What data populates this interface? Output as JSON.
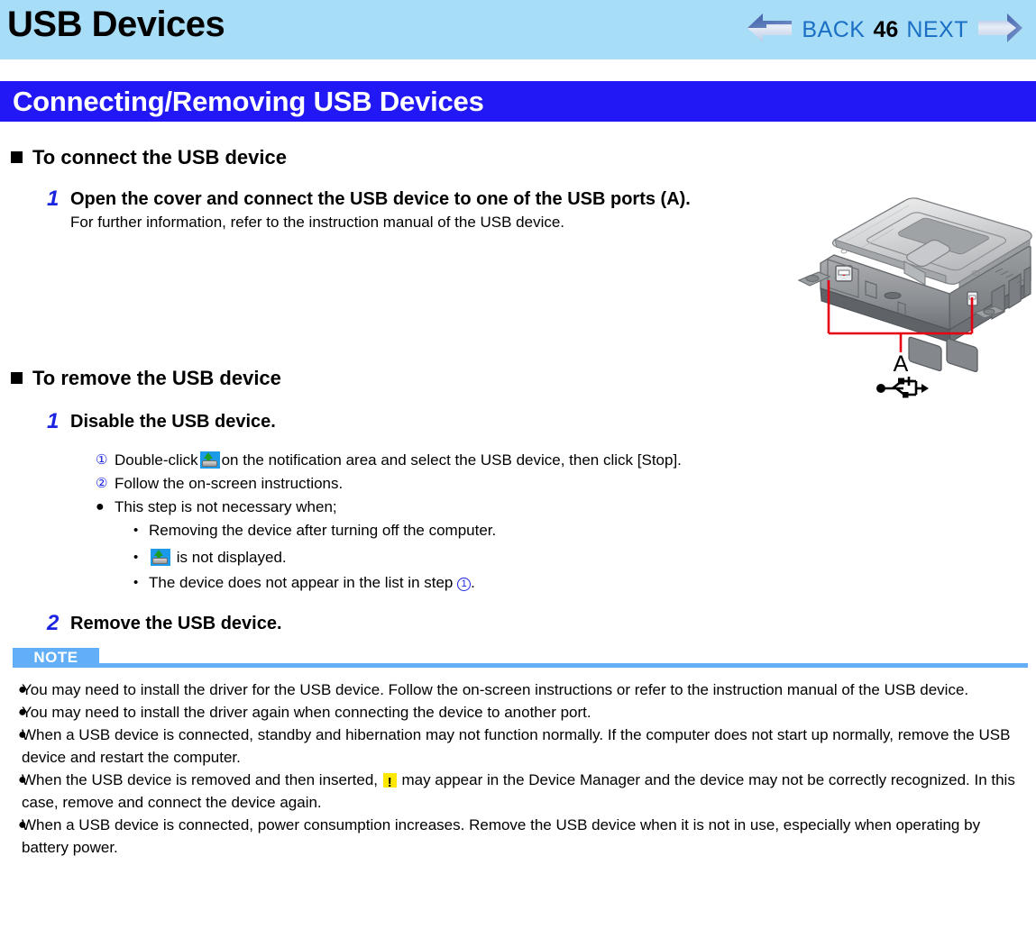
{
  "header": {
    "title": "USB Devices",
    "nav": {
      "back_label": "BACK",
      "page_number": "46",
      "next_label": "NEXT",
      "back_arrow_icon": "arrow-left-icon",
      "next_arrow_icon": "arrow-right-icon"
    },
    "bg_color": "#a8ddf7",
    "link_color": "#1a6fc4"
  },
  "section": {
    "banner_title": "Connecting/Removing USB Devices",
    "banner_color": "#2118f5"
  },
  "connect": {
    "heading": "To connect the USB device",
    "step1_number": "1",
    "step1_title": "Open the cover and connect the USB device to one of the USB ports (A).",
    "step1_note": "For further information, refer to the instruction manual of the USB device."
  },
  "illustration": {
    "callout_label": "A",
    "usb_symbol_name": "usb-symbol-icon",
    "device_name": "rugged-laptop-rear-view",
    "callout_color": "#e60012"
  },
  "remove": {
    "heading": "To remove the USB device",
    "step1_number": "1",
    "step1_title": "Disable the USB device.",
    "sub_items": [
      {
        "marker": "①",
        "text_before_icon": "Double-click",
        "icon": "safely-remove-hardware-icon",
        "text_after_icon": "on the notification area and select the USB device, then click [Stop]."
      },
      {
        "marker": "②",
        "text": "Follow the on-screen instructions."
      }
    ],
    "condition_bullet": "●",
    "condition_intro": "This step is not necessary when;",
    "conditions": [
      {
        "marker": "•",
        "text": "Removing the device after turning off the computer."
      },
      {
        "marker": "•",
        "text_before_icon": "",
        "icon": "safely-remove-hardware-icon",
        "text_after_icon": "is not displayed."
      },
      {
        "marker": "•",
        "text_before_circle": "The device does not appear in the list in step",
        "circle": "1",
        "text_after_circle": "."
      }
    ],
    "step2_number": "2",
    "step2_title": "Remove the USB device."
  },
  "note": {
    "label": "NOTE",
    "badge_color": "#62aff7",
    "bullet": "●",
    "items": [
      {
        "text": "You may need to install the driver for the USB device. Follow the on-screen instructions or refer to the instruction manual of the USB device."
      },
      {
        "text": "You may need to install the driver again when connecting the device to another port."
      },
      {
        "text": "When a USB device is connected, standby and hibernation may not function normally. If the computer does not start up normally, remove the USB device and restart the computer."
      },
      {
        "text_before_icon": "When the USB device is removed and then inserted,",
        "icon": "warning-exclamation-icon",
        "text_after_icon": "may appear in the Device Manager and the device may not be correctly recognized. In this case, remove and connect the device again."
      },
      {
        "text": "When a USB device is connected, power consumption increases. Remove the USB device when it is not in use, especially when operating by battery power."
      }
    ]
  }
}
